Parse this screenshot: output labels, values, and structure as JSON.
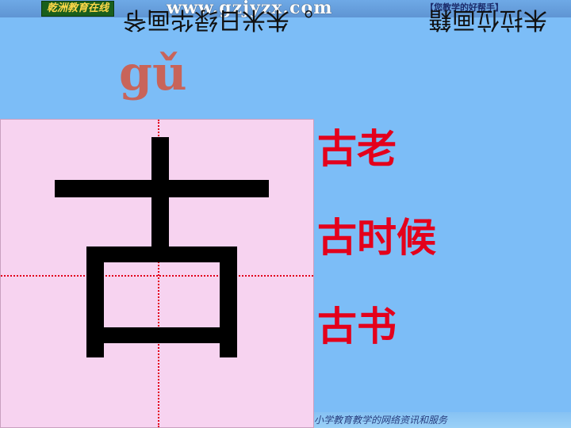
{
  "header": {
    "brand": "乾洲教育在线",
    "url": "www.gzjyzx.com",
    "tagline": "【您教学的好帮手】"
  },
  "mirrored_text": {
    "left": "。朱米日绿华画爷",
    "right": "朱拉位画籍"
  },
  "pinyin": "gǔ",
  "character": "古",
  "words": [
    "古老",
    "古时候",
    "古书"
  ],
  "footer": "小学教育教学的网络资讯和服务",
  "colors": {
    "background": "#7cbdf7",
    "grid_background": "#f7d3f0",
    "grid_line": "#e2001a",
    "word_text": "#e4001b",
    "pinyin": "#c8645a"
  }
}
